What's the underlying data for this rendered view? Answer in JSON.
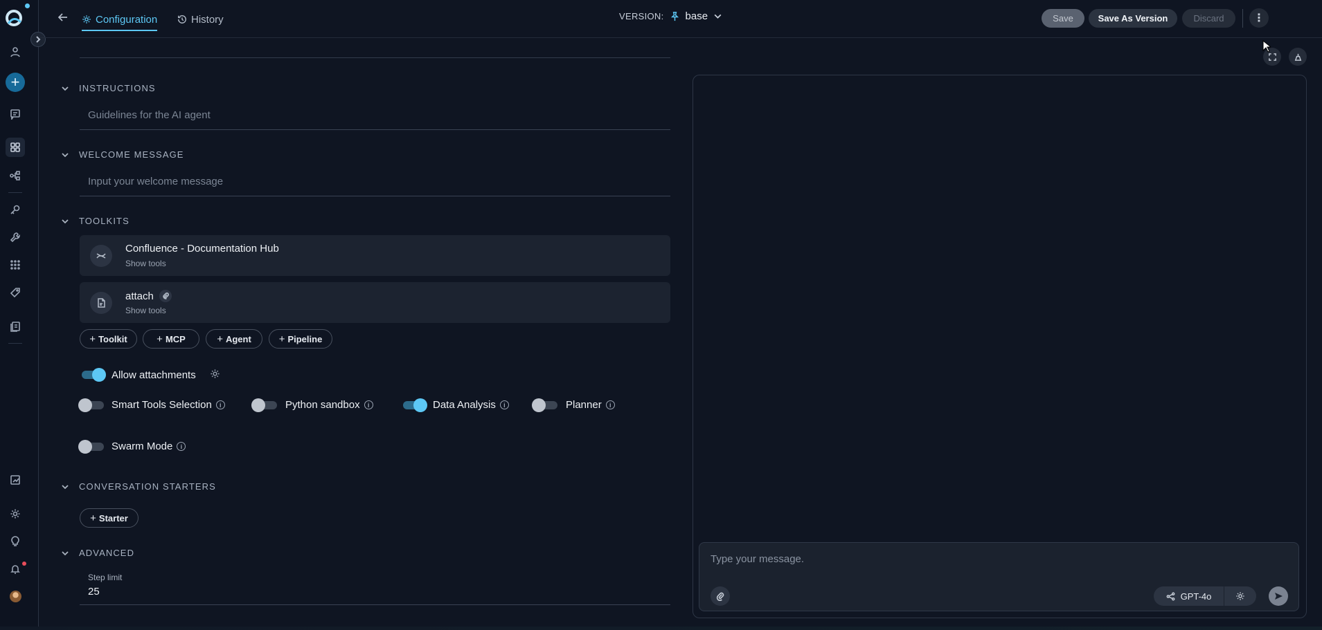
{
  "topbar": {
    "tabs": [
      {
        "label": "Configuration",
        "active": true
      },
      {
        "label": "History",
        "active": false
      }
    ],
    "version_label": "VERSION:",
    "version_value": "base",
    "save_label": "Save",
    "save_as_version_label": "Save As Version",
    "discard_label": "Discard"
  },
  "sections": {
    "instructions": {
      "title": "INSTRUCTIONS",
      "placeholder": "Guidelines for the AI agent"
    },
    "welcome": {
      "title": "WELCOME MESSAGE",
      "placeholder": "Input your welcome message"
    },
    "toolkits": {
      "title": "TOOLKITS",
      "items": [
        {
          "name": "Confluence - Documentation Hub",
          "sub": "Show tools",
          "icon": "confluence-icon"
        },
        {
          "name": "attach",
          "sub": "Show tools",
          "icon": "file-icon"
        }
      ],
      "add_buttons": [
        "Toolkit",
        "MCP",
        "Agent",
        "Pipeline"
      ]
    },
    "toggles": {
      "allow_attachments": {
        "label": "Allow attachments",
        "on": true
      },
      "smart_tools": {
        "label": "Smart Tools Selection",
        "on": false
      },
      "python_sandbox": {
        "label": "Python sandbox",
        "on": false
      },
      "data_analysis": {
        "label": "Data Analysis",
        "on": true
      },
      "planner": {
        "label": "Planner",
        "on": false
      },
      "swarm_mode": {
        "label": "Swarm Mode",
        "on": false
      }
    },
    "starters": {
      "title": "CONVERSATION STARTERS",
      "add_label": "Starter"
    },
    "advanced": {
      "title": "ADVANCED",
      "step_limit_label": "Step limit",
      "step_limit_value": "25"
    }
  },
  "chat": {
    "placeholder": "Type your message.",
    "model": "GPT-4o"
  },
  "colors": {
    "accent": "#5dc8f5",
    "background": "#0f1522"
  }
}
